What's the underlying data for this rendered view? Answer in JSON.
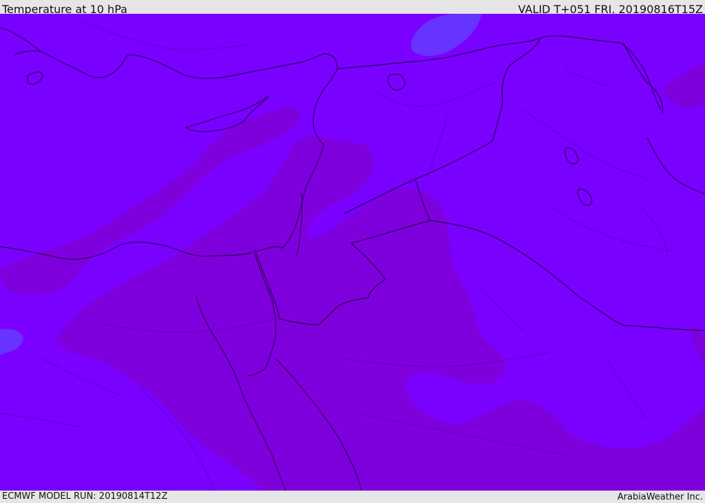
{
  "header": {
    "title": "Temperature at 10 hPa",
    "valid_time": "VALID T+051 FRI. 20190816T15Z"
  },
  "footer": {
    "model_run": "ECMWF MODEL RUN: 20190814T12Z",
    "credit": "ArabiaWeather Inc."
  },
  "map": {
    "colors": {
      "base_fill": "#7a00ff",
      "warm_band": "#7e00dd",
      "cold_patch": "#6633ff",
      "coastline": "#1a0033",
      "border": "#1a0033"
    }
  }
}
